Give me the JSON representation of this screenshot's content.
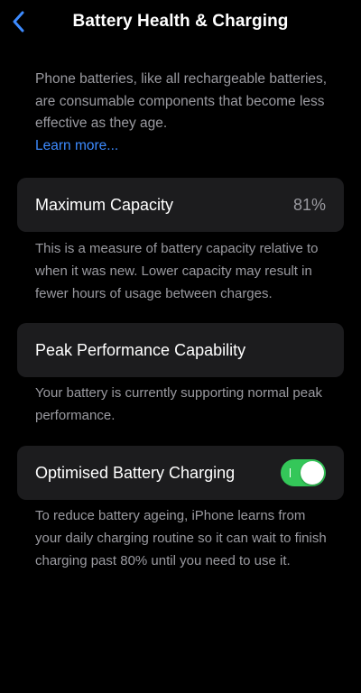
{
  "nav": {
    "title": "Battery Health & Charging",
    "back_icon": "chevron-left-icon"
  },
  "intro": {
    "text": "Phone batteries, like all rechargeable batteries, are consumable components that become less effective as they age.",
    "link_label": "Learn more..."
  },
  "max_capacity": {
    "label": "Maximum Capacity",
    "value": "81%",
    "footnote": "This is a measure of battery capacity relative to when it was new. Lower capacity may result in fewer hours of usage between charges."
  },
  "peak_performance": {
    "label": "Peak Performance Capability",
    "footnote": "Your battery is currently supporting normal peak performance."
  },
  "optimised_charging": {
    "label": "Optimised Battery Charging",
    "enabled": true,
    "footnote": "To reduce battery ageing, iPhone learns from your daily charging routine so it can wait to finish charging past 80% until you need to use it."
  },
  "colors": {
    "background": "#000000",
    "card": "#1c1c1e",
    "accent_blue": "#3d8bff",
    "toggle_on": "#34c759",
    "secondary_text": "#9a9aa0"
  }
}
